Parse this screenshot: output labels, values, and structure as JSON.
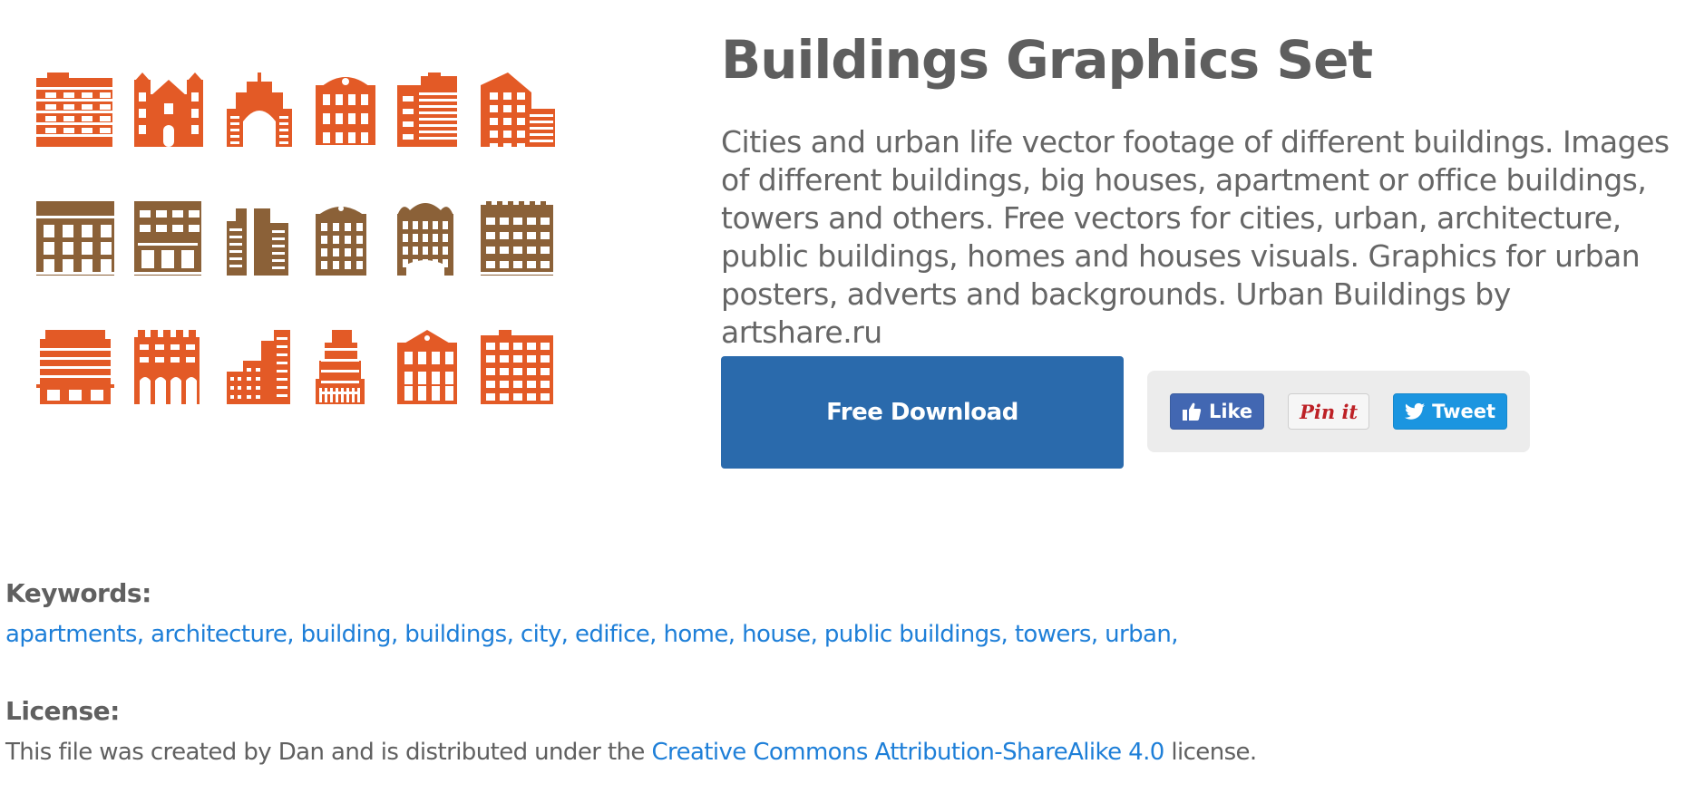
{
  "preview": {
    "alt": "Buildings Graphics Set preview",
    "colors": {
      "orange": "#e35a26",
      "brown": "#8b6138"
    },
    "rows": [
      {
        "color": "orange",
        "icons": [
          "apartment-block-icon",
          "church-icon",
          "arch-gate-icon",
          "ornate-townhouse-icon",
          "office-tower-icon",
          "modern-office-icon"
        ]
      },
      {
        "color": "brown",
        "icons": [
          "classic-townhouse-icon",
          "shop-building-icon",
          "twin-towers-icon",
          "mansard-house-icon",
          "gabled-house-icon",
          "wide-apartment-icon"
        ]
      },
      {
        "color": "orange",
        "icons": [
          "hotel-icon",
          "arcade-building-icon",
          "skyline-icon",
          "stepped-tower-icon",
          "gable-building-icon",
          "block-building-icon"
        ]
      }
    ]
  },
  "info": {
    "title": "Buildings Graphics Set",
    "description": "Cities and urban life vector footage of different buildings. Images of different buildings, big houses, apartment or office buildings, towers and others. Free vectors for cities, urban, architecture, public buildings, homes and houses visuals. Graphics for urban posters, adverts and backgrounds. Urban Buildings by artshare.ru"
  },
  "actions": {
    "download_label": "Free Download",
    "download_color": "#2a6aac",
    "like_label": "Like",
    "pin_label": "Pin it",
    "tweet_label": "Tweet"
  },
  "keywords": {
    "label": "Keywords:",
    "items": [
      "apartments,",
      "architecture,",
      "building,",
      "buildings,",
      "city,",
      "edifice,",
      "home,",
      "house,",
      "public buildings,",
      "towers,",
      "urban,"
    ],
    "link_color": "#1e7fd8"
  },
  "license": {
    "label": "License:",
    "text_before": "This file was created by Dan and is distributed under the ",
    "link_text": "Creative Commons Attribution-ShareAlike 4.0",
    "text_after": " license."
  }
}
